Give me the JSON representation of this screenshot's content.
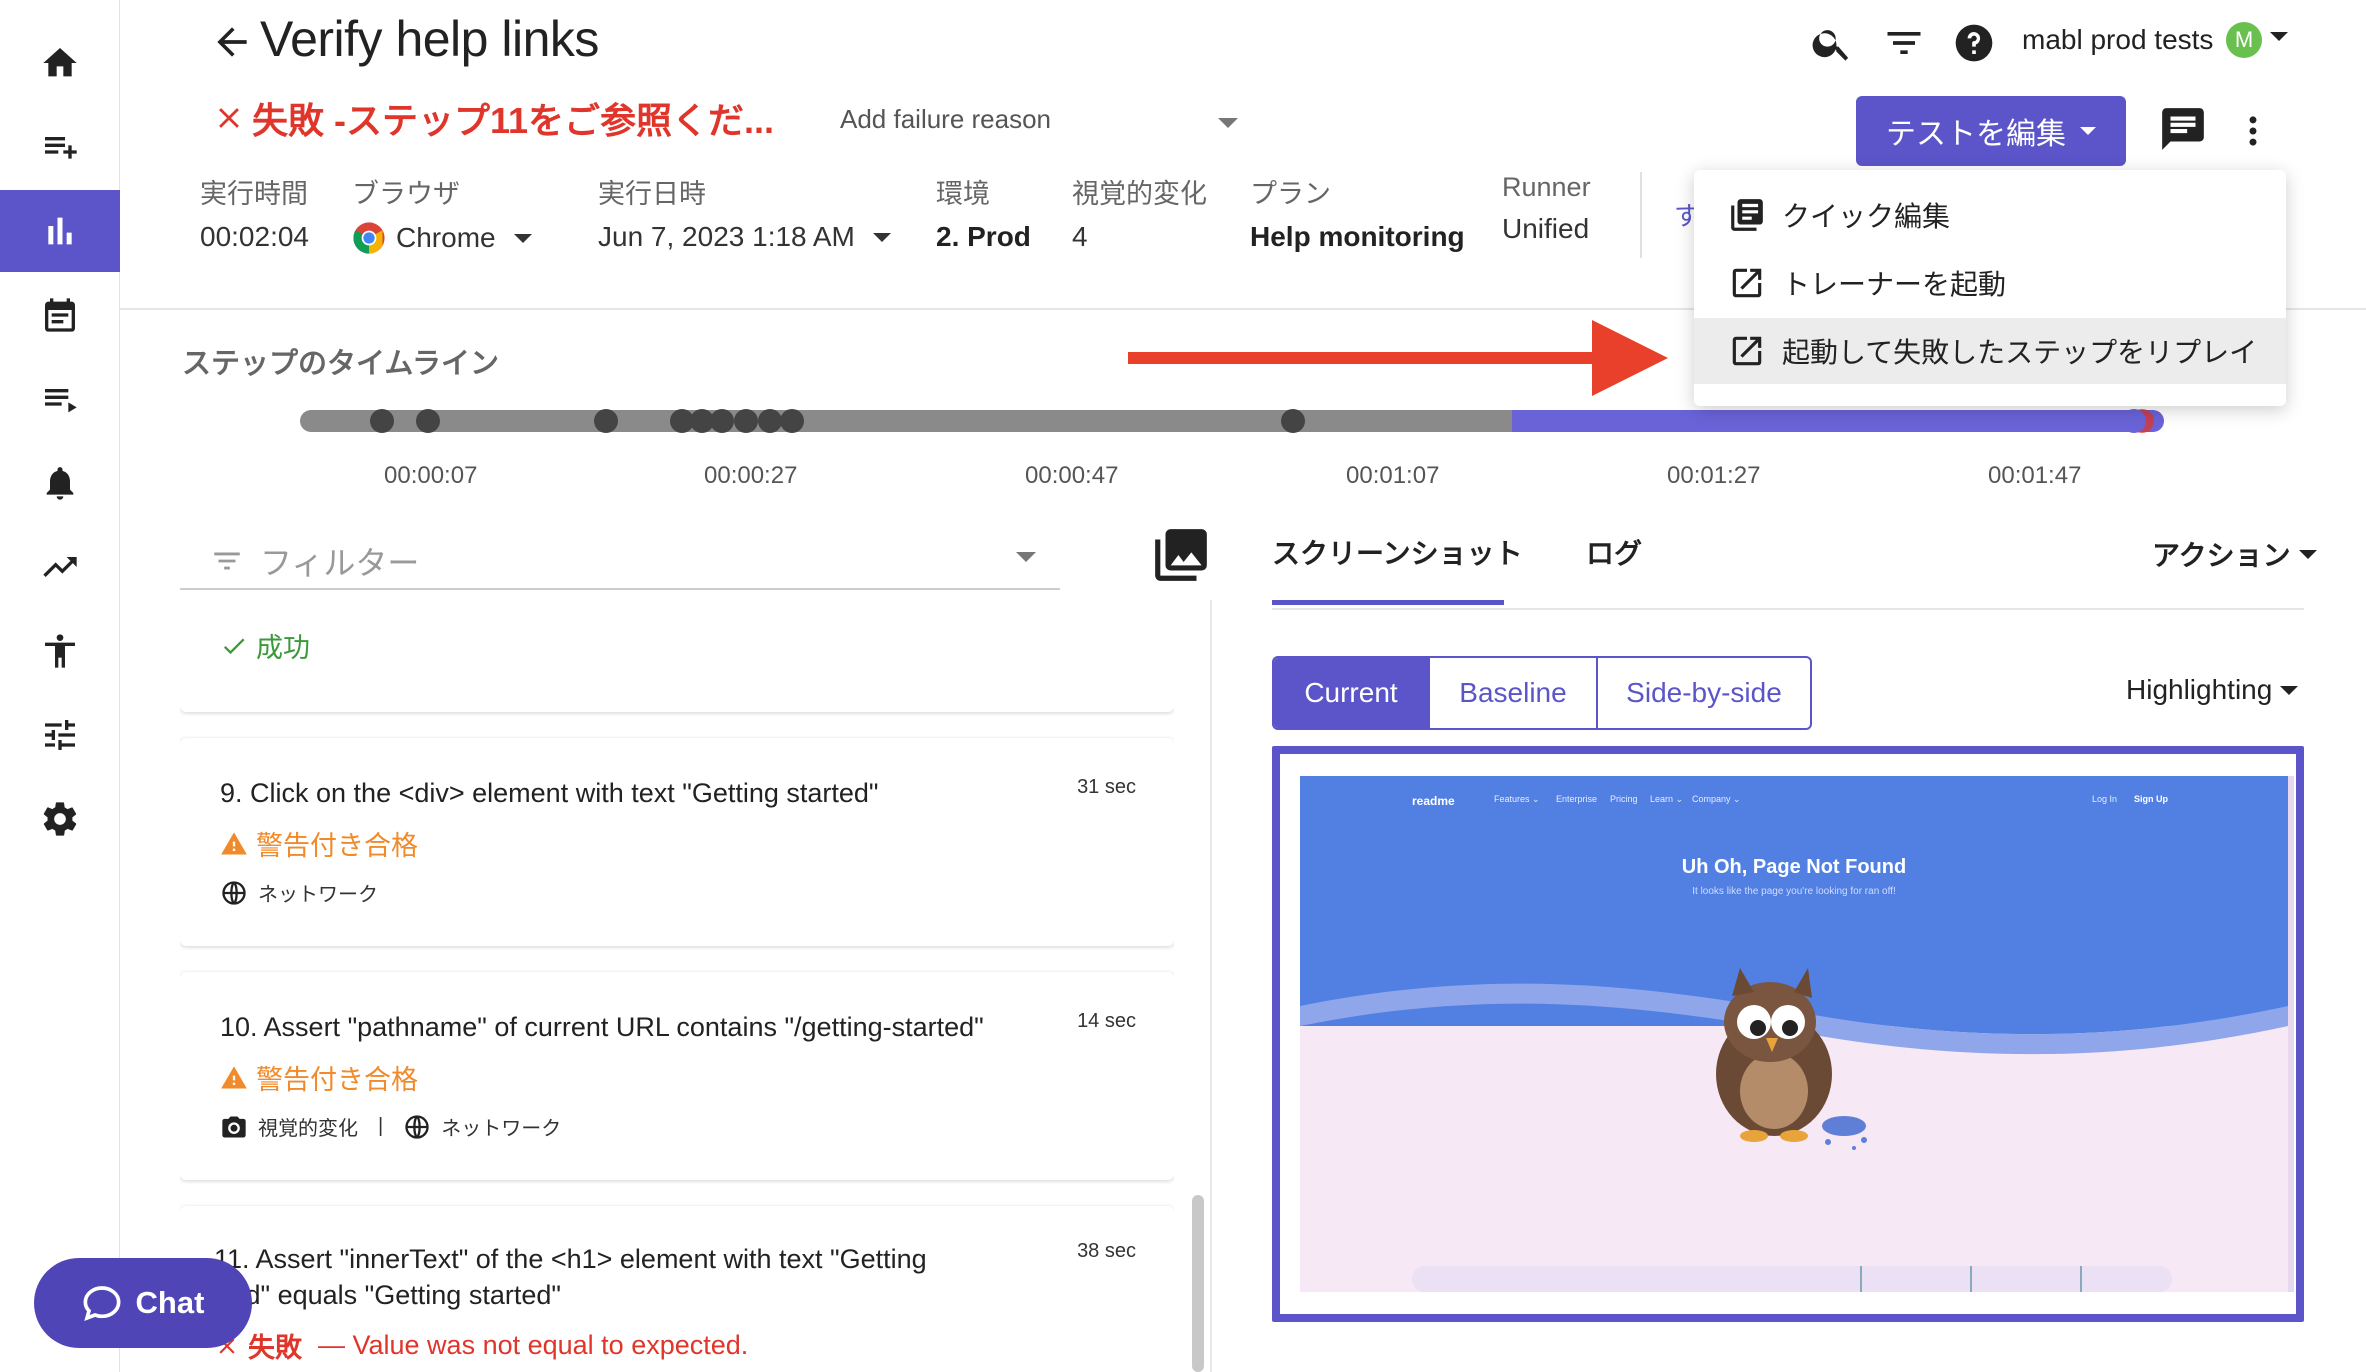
{
  "header": {
    "title": "Verify help links",
    "fail_text": "失敗 -ステップ11をご参照くだ...",
    "failure_reason_placeholder": "Add failure reason",
    "edit_button": "テストを編集",
    "user": "mabl prod tests",
    "avatar_letter": "M"
  },
  "meta": [
    {
      "label": "実行時間",
      "value": "00:02:04"
    },
    {
      "label": "ブラウザ",
      "value": "Chrome"
    },
    {
      "label": "実行日時",
      "value": "Jun 7, 2023 1:18 AM"
    },
    {
      "label": "環境",
      "value": "2. Prod"
    },
    {
      "label": "視覚的変化",
      "value": "4"
    },
    {
      "label": "プラン",
      "value": "Help monitoring"
    },
    {
      "label": "Runner",
      "value": "Unified"
    }
  ],
  "hidden_meta_fragment": "す",
  "menu": {
    "items": [
      {
        "label": "クイック編集",
        "icon": "quick-edit-icon"
      },
      {
        "label": "トレーナーを起動",
        "icon": "open-external-icon"
      },
      {
        "label": "起動して失敗したステップをリプレイ",
        "icon": "open-external-icon"
      }
    ]
  },
  "timeline": {
    "title": "ステップのタイムライン",
    "ticks": [
      "00:00:07",
      "00:00:27",
      "00:00:47",
      "00:01:07",
      "00:01:27",
      "00:01:47"
    ]
  },
  "filter": {
    "placeholder": "フィルター"
  },
  "steps": [
    {
      "status": "成功"
    },
    {
      "title": "9. Click on the <div> element with text \"Getting started\"",
      "time": "31 sec",
      "status": "警告付き合格",
      "tags": [
        "ネットワーク"
      ]
    },
    {
      "title": "10. Assert \"pathname\" of current URL contains \"/getting-started\"",
      "time": "14 sec",
      "status": "警告付き合格",
      "tags": [
        "視覚的変化",
        "ネットワーク"
      ]
    },
    {
      "title_line1": "11. Assert \"innerText\" of the <h1> element with text \"Getting",
      "title_line2": "rted\" equals \"Getting started\"",
      "time": "38 sec",
      "status": "失敗",
      "status_detail": "— Value was not equal to expected."
    }
  ],
  "right_panel": {
    "tabs": [
      "スクリーンショット",
      "ログ"
    ],
    "actions": "アクション",
    "segments": [
      "Current",
      "Baseline",
      "Side-by-side"
    ],
    "highlighting": "Highlighting"
  },
  "screenshot": {
    "brand": "readme",
    "nav": [
      "Features ⌄",
      "Enterprise",
      "Pricing",
      "Learn ⌄",
      "Company ⌄"
    ],
    "login": "Log In",
    "signup": "Sign Up",
    "heading": "Uh Oh, Page Not Found",
    "sub": "It looks like the page you're looking for ran off!"
  },
  "chat": {
    "label": "Chat"
  },
  "colors": {
    "accent": "#5b55c9",
    "error": "#e0352b",
    "warning": "#f08a2a",
    "success": "#3a9a3a"
  }
}
